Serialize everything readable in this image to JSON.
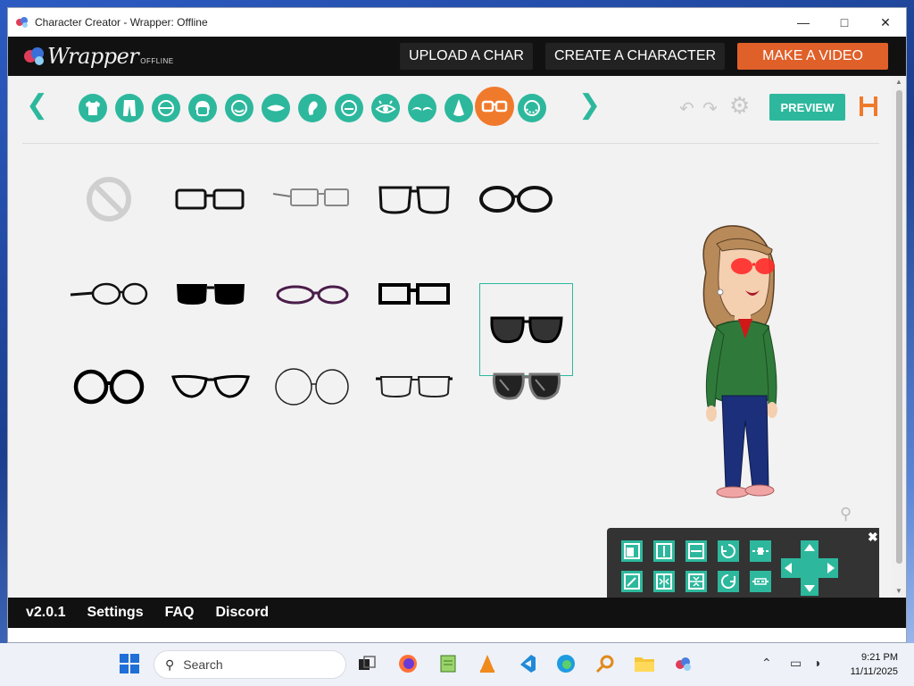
{
  "window": {
    "title": "Character Creator - Wrapper: Offline"
  },
  "header": {
    "logo_word": "Wrapper",
    "logo_sub": "OFFLINE",
    "upload_label": "UPLOAD A CHAR",
    "create_label": "CREATE A CHARACTER",
    "video_label": "MAKE A VIDEO"
  },
  "toolbar": {
    "categories": [
      "shirt",
      "pants",
      "head",
      "hair",
      "face",
      "mouth",
      "ear",
      "mouth-alt",
      "eye",
      "eyebrow",
      "nose",
      "glasses",
      "beard"
    ],
    "active_category": "glasses",
    "preview_label": "PREVIEW"
  },
  "glasses_options": [
    "none",
    "rectangle-thin",
    "rectangle-grey-side",
    "square-thick",
    "oval-thick",
    "round-side",
    "sunglasses-black",
    "oval-purple",
    "rectangle-bold",
    "sunglasses-dark",
    "round-thick",
    "cateye",
    "round-large-thin",
    "rectangle-thin-wide",
    "aviator-dark"
  ],
  "selected_option": "sunglasses-dark",
  "footer": {
    "version": "v2.0.1",
    "settings": "Settings",
    "faq": "FAQ",
    "discord": "Discord"
  },
  "taskbar": {
    "search_placeholder": "Search",
    "time": "9:21 PM",
    "date": "11/11/2025"
  },
  "colors": {
    "accent": "#2db89d",
    "active": "#f07a2c",
    "primary_btn": "#e0602a",
    "header_bg": "#111111"
  }
}
